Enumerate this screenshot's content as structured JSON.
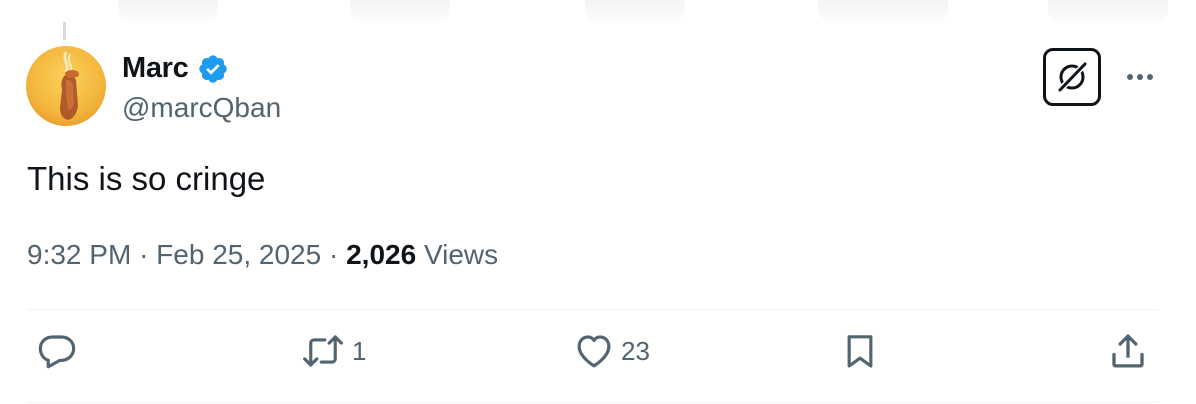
{
  "author": {
    "name": "Marc",
    "handle": "@marcQban",
    "verified": true,
    "verified_color": "#1d9bf0"
  },
  "tweet": {
    "text": "This is so cringe",
    "time": "9:32 PM",
    "date": "Feb 25, 2025",
    "views_count": "2,026",
    "views_label": "Views",
    "separator": "·"
  },
  "actions": {
    "reply": {
      "icon": "reply-icon",
      "count": ""
    },
    "retweet": {
      "icon": "retweet-icon",
      "count": "1"
    },
    "like": {
      "icon": "heart-icon",
      "count": "23"
    },
    "bookmark": {
      "icon": "bookmark-icon",
      "count": ""
    },
    "share": {
      "icon": "share-icon",
      "count": ""
    }
  },
  "colors": {
    "text": "#0f1419",
    "secondary": "#536471",
    "divider": "#eff3f4"
  }
}
